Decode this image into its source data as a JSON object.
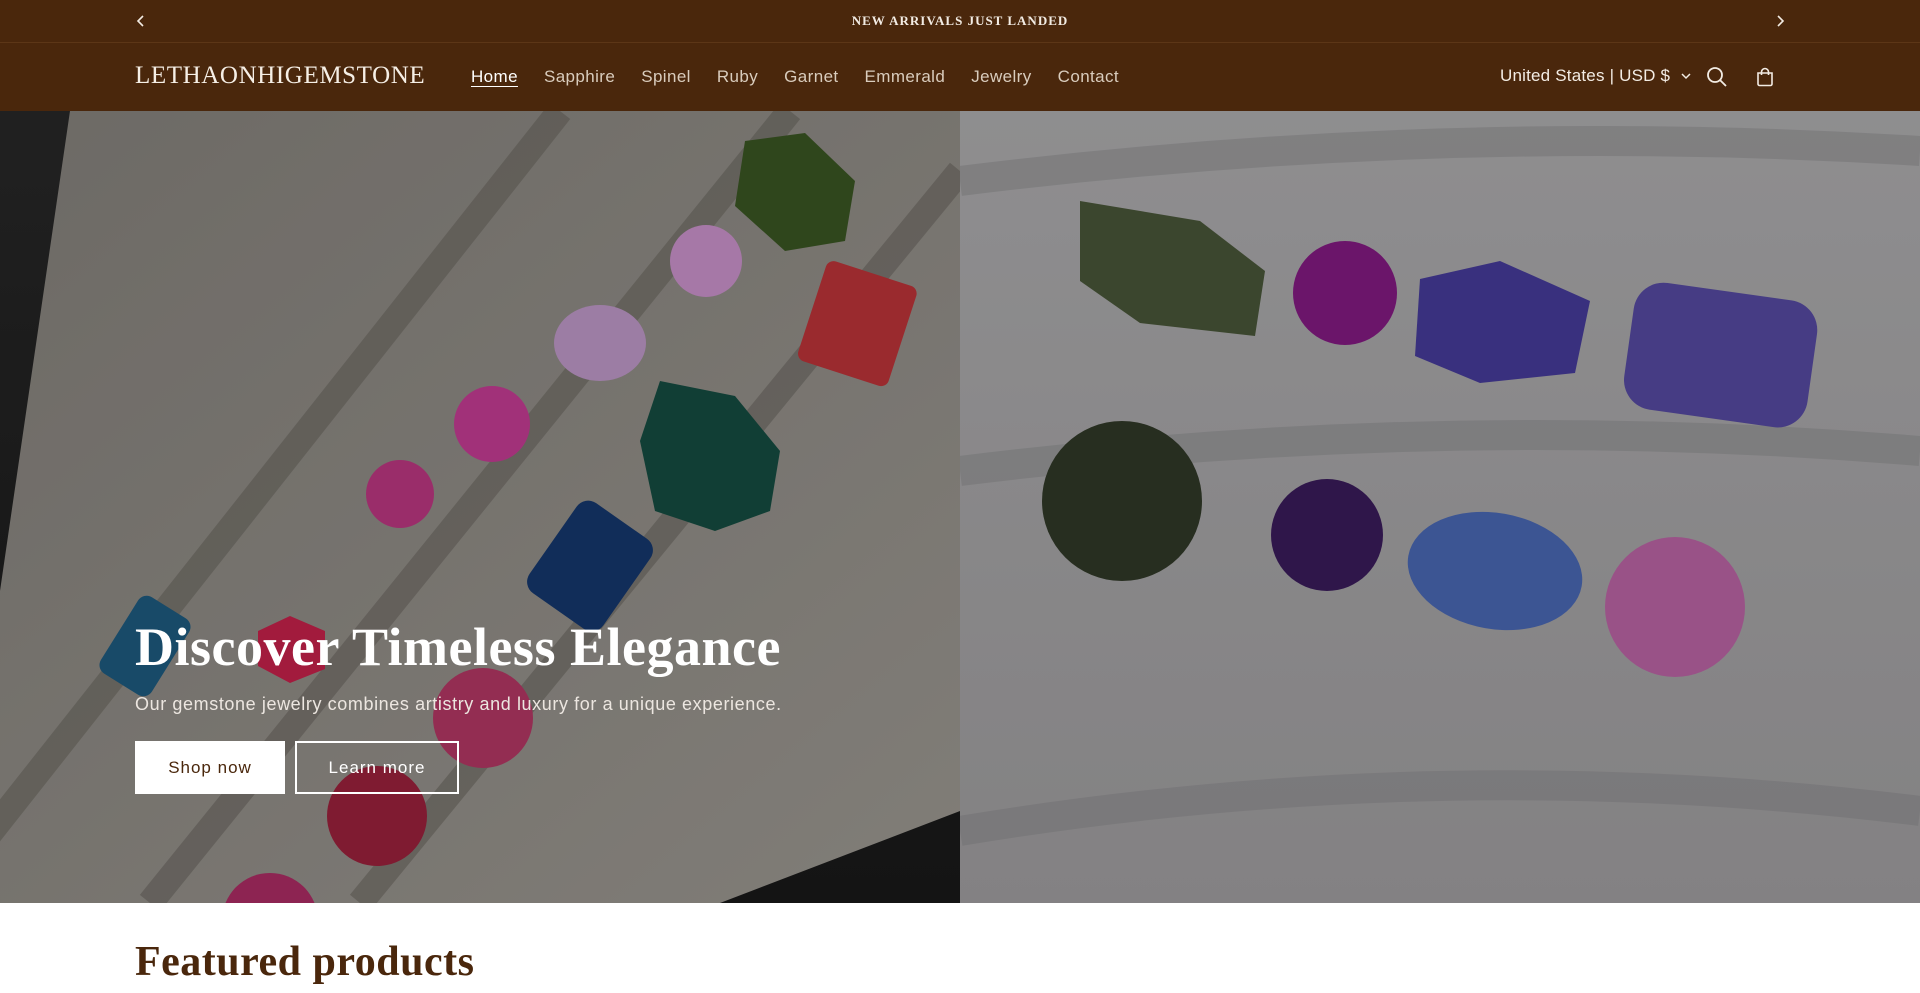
{
  "announcement": {
    "text": "NEW ARRIVALS JUST LANDED",
    "prev_icon": "chevron-left-icon",
    "next_icon": "chevron-right-icon"
  },
  "header": {
    "logo": "LETHAONHIGEMSTONE",
    "nav": [
      {
        "label": "Home",
        "active": true
      },
      {
        "label": "Sapphire",
        "active": false
      },
      {
        "label": "Spinel",
        "active": false
      },
      {
        "label": "Ruby",
        "active": false
      },
      {
        "label": "Garnet",
        "active": false
      },
      {
        "label": "Emmerald",
        "active": false
      },
      {
        "label": "Jewelry",
        "active": false
      },
      {
        "label": "Contact",
        "active": false
      }
    ],
    "locale": "United States | USD $",
    "icons": [
      "search-icon",
      "cart-icon"
    ]
  },
  "hero": {
    "title": "Discover Timeless Elegance",
    "subtitle": "Our gemstone jewelry combines artistry and luxury for a unique experience.",
    "primary_button": "Shop now",
    "secondary_button": "Learn more"
  },
  "featured": {
    "title": "Featured products"
  },
  "colors": {
    "brand": "#4a270c",
    "white": "#ffffff"
  }
}
